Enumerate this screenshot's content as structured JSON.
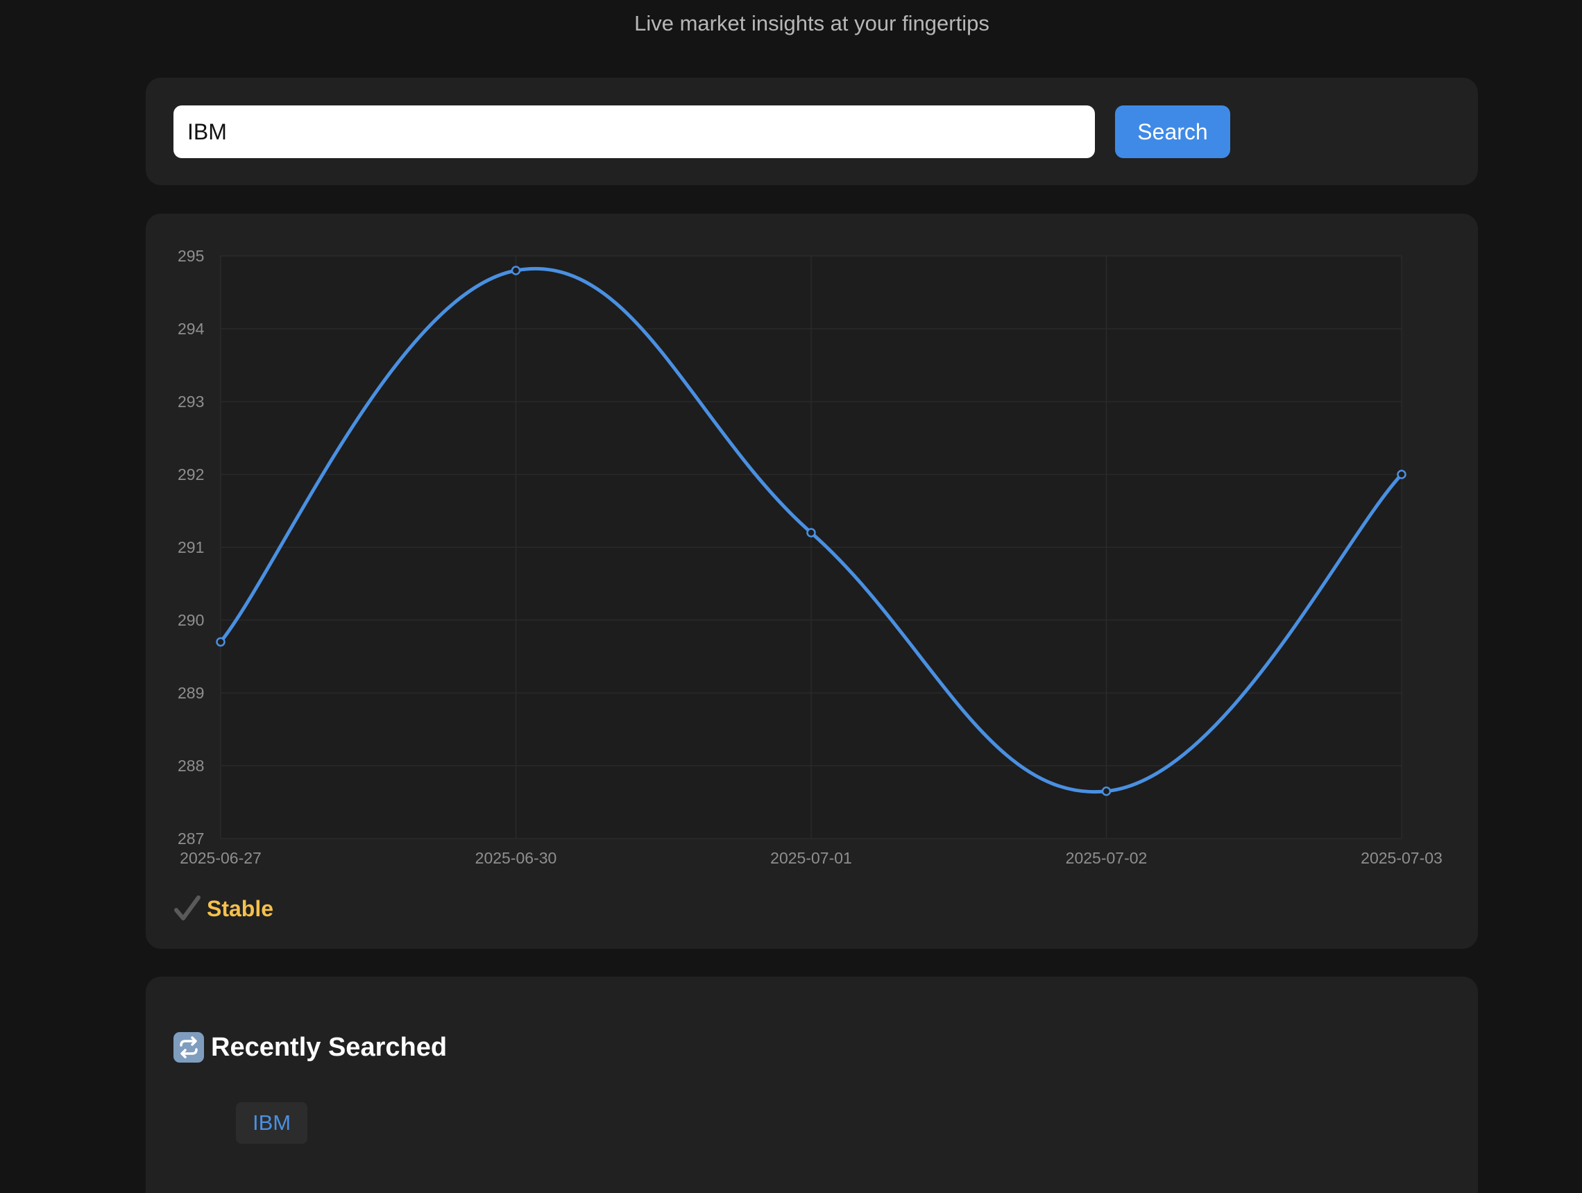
{
  "header": {
    "subtitle": "Live market insights at your fingertips"
  },
  "search": {
    "value": "IBM",
    "button_label": "Search"
  },
  "chart_data": {
    "type": "line",
    "categories": [
      "2025-06-27",
      "2025-06-30",
      "2025-07-01",
      "2025-07-02",
      "2025-07-03"
    ],
    "series": [
      {
        "values": [
          289.7,
          294.8,
          291.2,
          287.65,
          292.0
        ]
      }
    ],
    "ylim": [
      287,
      295
    ],
    "yticks": [
      287,
      288,
      289,
      290,
      291,
      292,
      293,
      294,
      295
    ],
    "grid": true,
    "line_color": "#4a90e2"
  },
  "status": {
    "icon": "check-icon",
    "label": "Stable",
    "color": "#f5c04d"
  },
  "recent": {
    "icon": "repeat-icon",
    "title": "Recently Searched",
    "items": [
      "IBM"
    ]
  }
}
